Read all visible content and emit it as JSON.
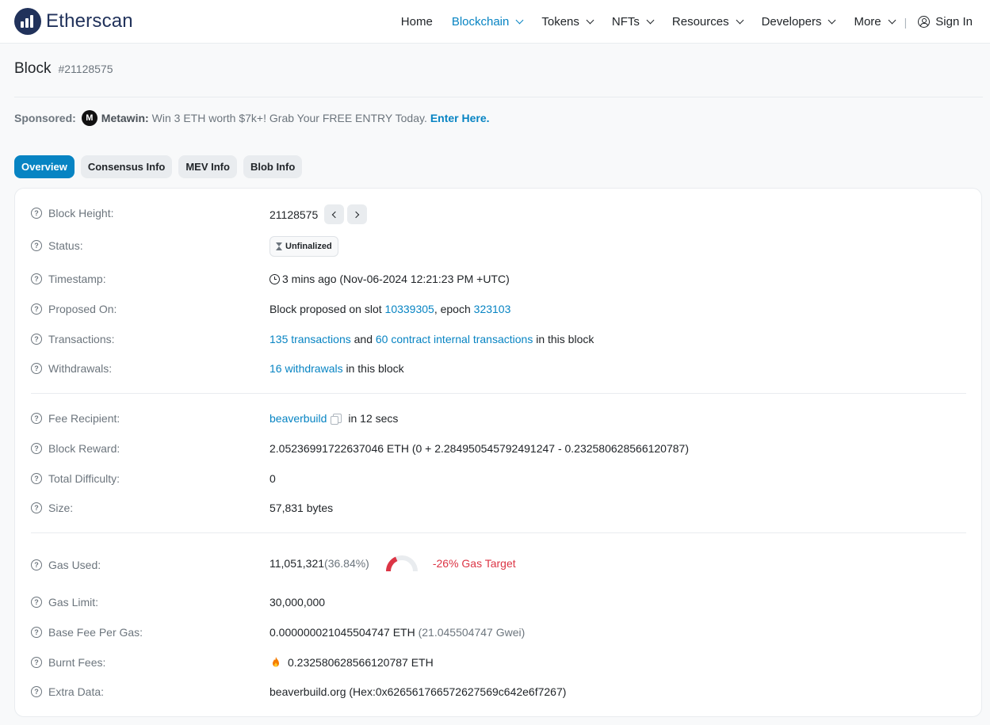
{
  "header": {
    "brand": "Etherscan",
    "nav": [
      {
        "label": "Home"
      },
      {
        "label": "Blockchain"
      },
      {
        "label": "Tokens"
      },
      {
        "label": "NFTs"
      },
      {
        "label": "Resources"
      },
      {
        "label": "Developers"
      },
      {
        "label": "More"
      }
    ],
    "separator": "|",
    "sign_in": "Sign In"
  },
  "page": {
    "title": "Block",
    "block_number": "#21128575"
  },
  "sponsored": {
    "label": "Sponsored:",
    "brand": "Metawin:",
    "logo_text": "M",
    "text": "Win 3 ETH worth $7k+! Grab Your FREE ENTRY Today.",
    "cta": "Enter Here."
  },
  "tabs": [
    {
      "label": "Overview"
    },
    {
      "label": "Consensus Info"
    },
    {
      "label": "MEV Info"
    },
    {
      "label": "Blob Info"
    }
  ],
  "details": {
    "block_height": {
      "label": "Block Height:",
      "value": "21128575"
    },
    "status": {
      "label": "Status:",
      "value": "Unfinalized"
    },
    "timestamp": {
      "label": "Timestamp:",
      "value": "3 mins ago (Nov-06-2024 12:21:23 PM +UTC)"
    },
    "proposed_on": {
      "label": "Proposed On:",
      "prefix": "Block proposed on slot",
      "slot": "10339305",
      "mid": ", epoch",
      "epoch": "323103"
    },
    "transactions": {
      "label": "Transactions:",
      "tx_link": "135 transactions",
      "and": "and",
      "internal_link": "60 contract internal transactions",
      "suffix": "in this block"
    },
    "withdrawals": {
      "label": "Withdrawals:",
      "link": "16 withdrawals",
      "suffix": "in this block"
    },
    "fee_recipient": {
      "label": "Fee Recipient:",
      "link": "beaverbuild",
      "suffix": "in 12 secs"
    },
    "block_reward": {
      "label": "Block Reward:",
      "value": "2.05236991722637046 ETH (0 + 2.284950545792491247 - 0.232580628566120787)"
    },
    "total_difficulty": {
      "label": "Total Difficulty:",
      "value": "0"
    },
    "size": {
      "label": "Size:",
      "value": "57,831 bytes"
    },
    "gas_used": {
      "label": "Gas Used:",
      "value": "11,051,321",
      "percent_text": "(36.84%)",
      "percent": 36.84,
      "target": "-26% Gas Target"
    },
    "gas_limit": {
      "label": "Gas Limit:",
      "value": "30,000,000"
    },
    "base_fee": {
      "label": "Base Fee Per Gas:",
      "value": "0.000000021045504747 ETH",
      "gwei": "(21.045504747 Gwei)"
    },
    "burnt_fees": {
      "label": "Burnt Fees:",
      "value": "0.232580628566120787 ETH"
    },
    "extra_data": {
      "label": "Extra Data:",
      "value": "beaverbuild.org (Hex:0x626561766572627569c642e6f7267)"
    }
  },
  "colors": {
    "accent": "#0784c3",
    "gauge_fill": "#dc3545",
    "gauge_track": "#e9ecef"
  }
}
